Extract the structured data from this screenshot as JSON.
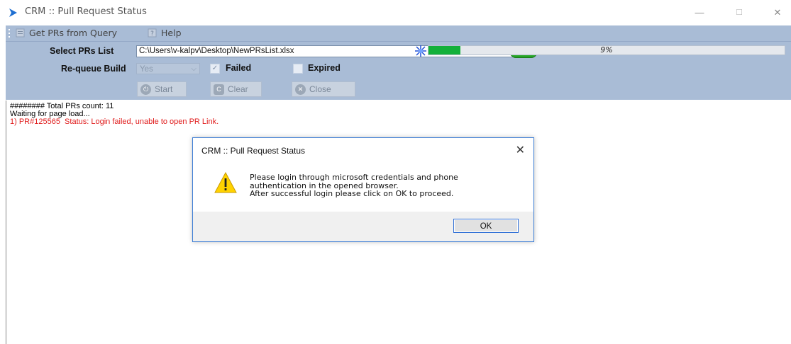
{
  "window": {
    "title": "CRM :: Pull Request Status",
    "minimize": "—",
    "maximize": "☐",
    "close": "✕"
  },
  "menu": {
    "get_prs": "Get PRs from Query",
    "help": "Help"
  },
  "form": {
    "select_label": "Select PRs List",
    "file_path": "C:\\Users\\v-kalpv\\Desktop\\NewPRsList.xlsx",
    "browse_label": "...",
    "requeue_label": "Re-queue Build",
    "requeue_value": "Yes",
    "failed_label": "Failed",
    "failed_checked": true,
    "expired_label": "Expired",
    "expired_checked": false
  },
  "toolbar": {
    "start": "Start",
    "clear": "Clear",
    "close": "Close"
  },
  "progress": {
    "percent": 9,
    "label": "9%",
    "color": "#12b03a"
  },
  "log": {
    "lines": [
      {
        "text": "######## Total PRs count: 11",
        "type": "info"
      },
      {
        "text": "Waiting for page load...",
        "type": "info"
      },
      {
        "text": "1) PR#125565  Status: Login failed, unable to open PR Link.",
        "type": "error"
      }
    ]
  },
  "dialog": {
    "title": "CRM :: Pull Request Status",
    "close": "✕",
    "message_lines": [
      "Please login through microsoft credentials and phone",
      "authentication in the opened browser.",
      "After successful login please click on OK to proceed."
    ],
    "ok": "OK"
  }
}
